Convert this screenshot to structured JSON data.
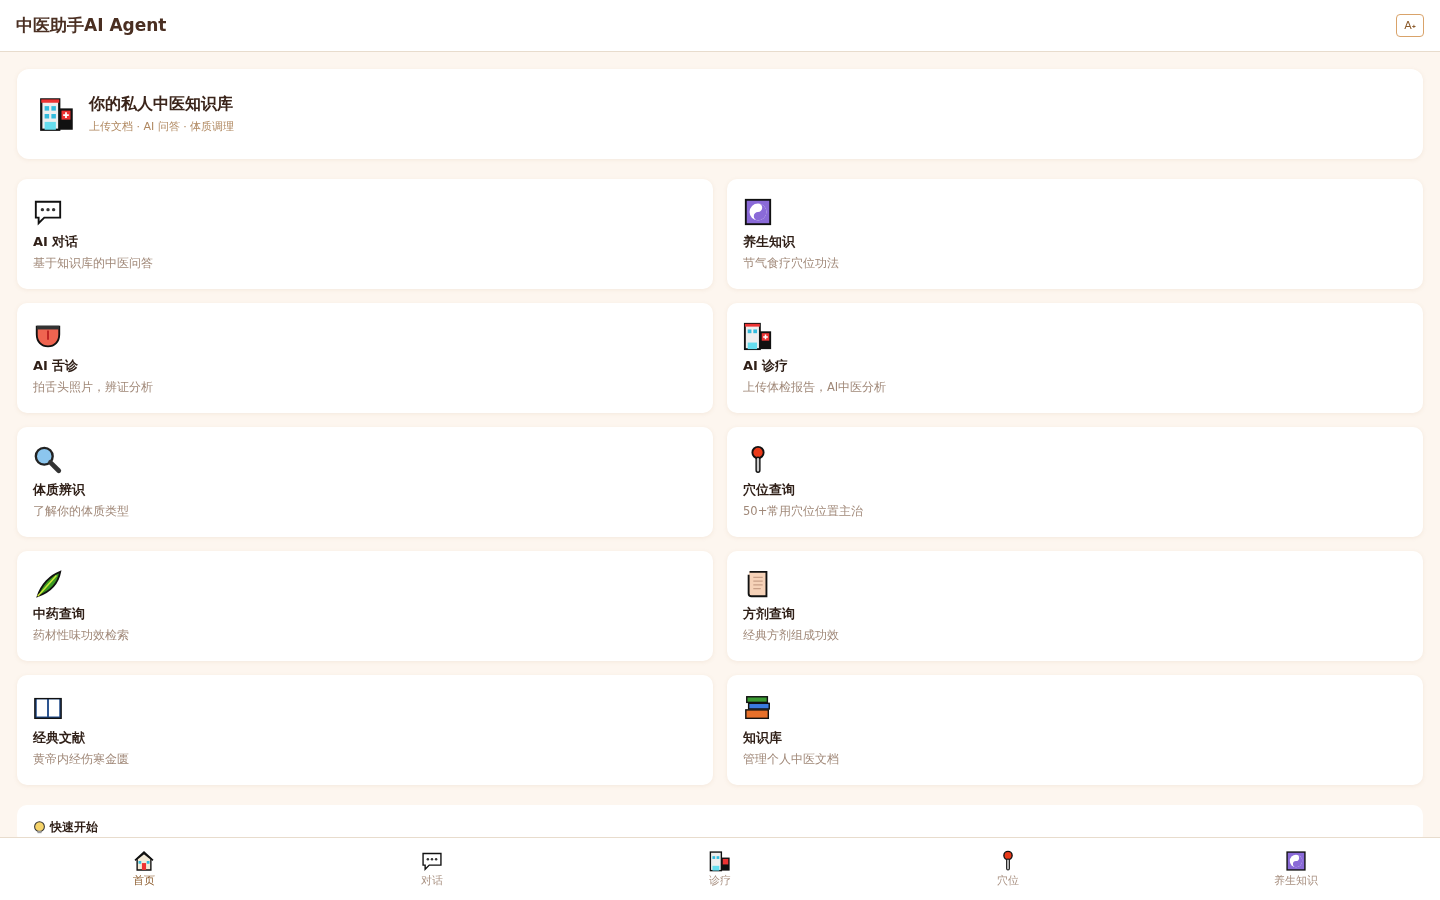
{
  "header": {
    "title": "中医助手AI Agent",
    "font_button": "A˖"
  },
  "hero": {
    "kind": "hospital",
    "title": "你的私人中医知识库",
    "subtitle": "上传文档 · AI 问答 · 体质调理"
  },
  "features": [
    {
      "kind": "chat",
      "title": "AI 对话",
      "subtitle": "基于知识库的中医问答"
    },
    {
      "kind": "yinyang",
      "title": "养生知识",
      "subtitle": "节气食疗穴位功法"
    },
    {
      "kind": "tongue",
      "title": "AI 舌诊",
      "subtitle": "拍舌头照片，辨证分析"
    },
    {
      "kind": "hospital",
      "title": "AI 诊疗",
      "subtitle": "上传体检报告，AI中医分析"
    },
    {
      "kind": "magnifier",
      "title": "体质辨识",
      "subtitle": "了解你的体质类型"
    },
    {
      "kind": "pin",
      "title": "穴位查询",
      "subtitle": "50+常用穴位位置主治"
    },
    {
      "kind": "leaf",
      "title": "中药查询",
      "subtitle": "药材性味功效检索"
    },
    {
      "kind": "scroll",
      "title": "方剂查询",
      "subtitle": "经典方剂组成功效"
    },
    {
      "kind": "book",
      "title": "经典文献",
      "subtitle": "黄帝内经伤寒金匮"
    },
    {
      "kind": "books",
      "title": "知识库",
      "subtitle": "管理个人中医文档"
    }
  ],
  "quick_start": {
    "kind": "bulb",
    "title": "快速开始"
  },
  "nav": [
    {
      "kind": "house",
      "label": "首页",
      "selected": true
    },
    {
      "kind": "chat",
      "label": "对话",
      "selected": false
    },
    {
      "kind": "hospital",
      "label": "诊疗",
      "selected": false
    },
    {
      "kind": "pin",
      "label": "穴位",
      "selected": false
    },
    {
      "kind": "yinyang",
      "label": "养生知识",
      "selected": false
    }
  ]
}
